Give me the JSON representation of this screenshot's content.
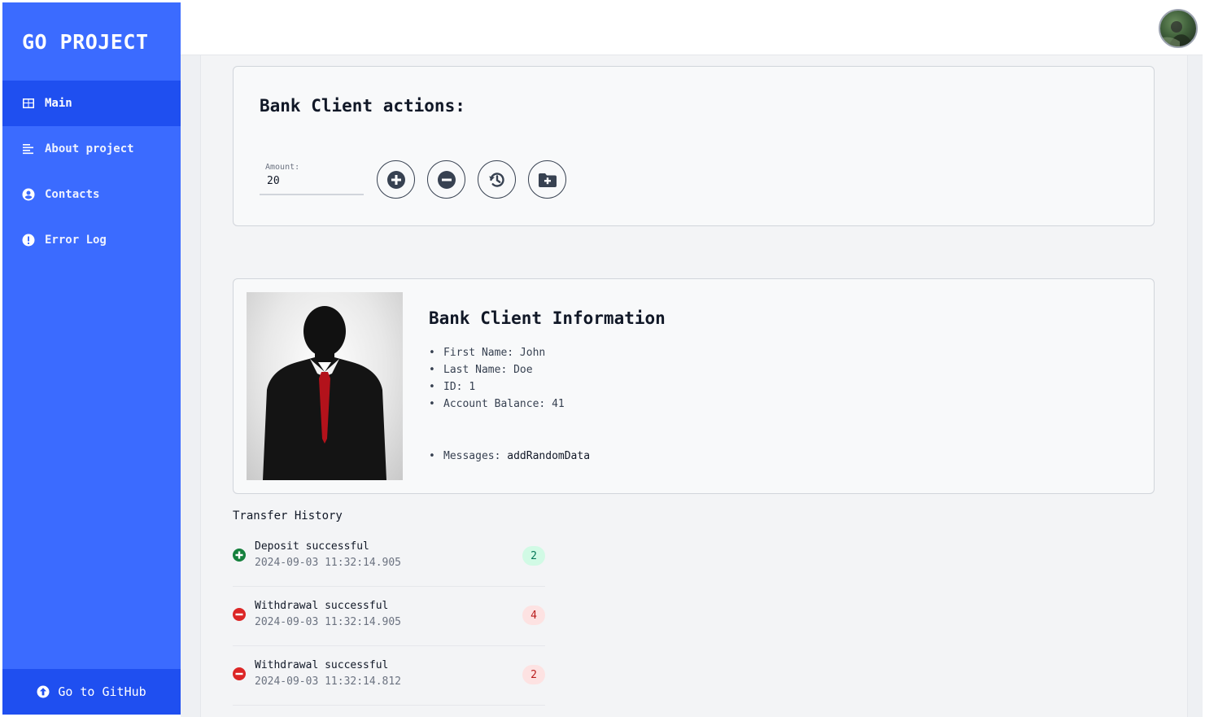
{
  "sidebar": {
    "logo": "GO PROJECT",
    "items": [
      {
        "label": "Main",
        "icon": "table-icon",
        "active": true
      },
      {
        "label": "About project",
        "icon": "align-left-icon",
        "active": false
      },
      {
        "label": "Contacts",
        "icon": "user-circle-icon",
        "active": false
      },
      {
        "label": "Error Log",
        "icon": "exclamation-circle-icon",
        "active": false
      }
    ],
    "github_label": "Go to GitHub",
    "github_icon": "arrow-up-circle-icon"
  },
  "topbar": {
    "avatar": "user-avatar"
  },
  "actions": {
    "title": "Bank Client actions:",
    "amount_label": "Amount:",
    "amount_value": "20",
    "buttons": [
      "deposit-plus-icon",
      "withdraw-minus-icon",
      "history-icon",
      "add-folder-icon"
    ]
  },
  "client": {
    "title": "Bank Client Information",
    "fields": [
      {
        "label": "First Name:",
        "value": "John"
      },
      {
        "label": "Last Name:",
        "value": "Doe"
      },
      {
        "label": "ID:",
        "value": "1"
      },
      {
        "label": "Account Balance:",
        "value": "41"
      }
    ],
    "messages_label": "Messages:",
    "messages_value": "addRandomData"
  },
  "history": {
    "title": "Transfer History",
    "items": [
      {
        "title": "Deposit successful",
        "time": "2024-09-03 11:32:14.905",
        "amount": "2",
        "type": "deposit"
      },
      {
        "title": "Withdrawal successful",
        "time": "2024-09-03 11:32:14.905",
        "amount": "4",
        "type": "withdraw"
      },
      {
        "title": "Withdrawal successful",
        "time": "2024-09-03 11:32:14.812",
        "amount": "2",
        "type": "withdraw"
      }
    ]
  },
  "colors": {
    "sidebar": "#3b6bff",
    "sidebar_active": "#1f4ff0",
    "deposit": "#15803d",
    "withdraw": "#dc2626"
  }
}
